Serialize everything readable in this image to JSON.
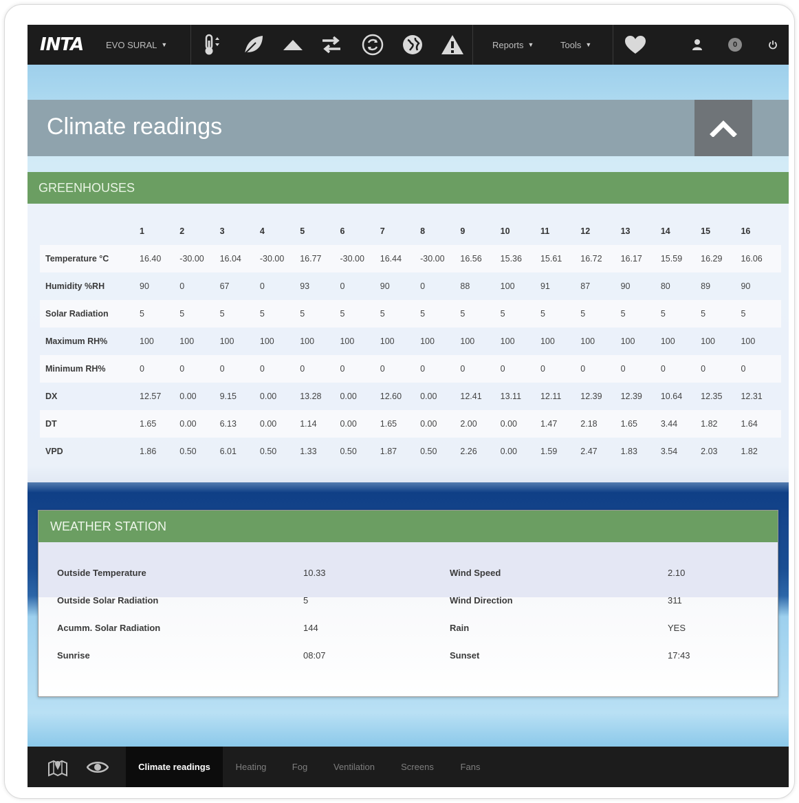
{
  "topbar": {
    "logo": "INTA",
    "site_selector": "EVO SURAL",
    "reports": "Reports",
    "tools": "Tools",
    "badge_count": "0",
    "icons": [
      "thermometer-icon",
      "leaf-icon",
      "triangle-up-icon",
      "exchange-icon",
      "refresh-icon",
      "globe-icon",
      "warning-icon",
      "heart-icon",
      "user-icon",
      "power-icon"
    ]
  },
  "title": "Climate readings",
  "greenhouses": {
    "header": "GREENHOUSES",
    "columns": [
      "1",
      "2",
      "3",
      "4",
      "5",
      "6",
      "7",
      "8",
      "9",
      "10",
      "11",
      "12",
      "13",
      "14",
      "15",
      "16"
    ],
    "rows": [
      {
        "label": "Temperature °C",
        "values": [
          "16.40",
          "-30.00",
          "16.04",
          "-30.00",
          "16.77",
          "-30.00",
          "16.44",
          "-30.00",
          "16.56",
          "15.36",
          "15.61",
          "16.72",
          "16.17",
          "15.59",
          "16.29",
          "16.06"
        ]
      },
      {
        "label": "Humidity %RH",
        "values": [
          "90",
          "0",
          "67",
          "0",
          "93",
          "0",
          "90",
          "0",
          "88",
          "100",
          "91",
          "87",
          "90",
          "80",
          "89",
          "90"
        ]
      },
      {
        "label": "Solar Radiation",
        "values": [
          "5",
          "5",
          "5",
          "5",
          "5",
          "5",
          "5",
          "5",
          "5",
          "5",
          "5",
          "5",
          "5",
          "5",
          "5",
          "5"
        ]
      },
      {
        "label": "Maximum RH%",
        "values": [
          "100",
          "100",
          "100",
          "100",
          "100",
          "100",
          "100",
          "100",
          "100",
          "100",
          "100",
          "100",
          "100",
          "100",
          "100",
          "100"
        ]
      },
      {
        "label": "Minimum RH%",
        "values": [
          "0",
          "0",
          "0",
          "0",
          "0",
          "0",
          "0",
          "0",
          "0",
          "0",
          "0",
          "0",
          "0",
          "0",
          "0",
          "0"
        ]
      },
      {
        "label": "DX",
        "values": [
          "12.57",
          "0.00",
          "9.15",
          "0.00",
          "13.28",
          "0.00",
          "12.60",
          "0.00",
          "12.41",
          "13.11",
          "12.11",
          "12.39",
          "12.39",
          "10.64",
          "12.35",
          "12.31"
        ]
      },
      {
        "label": "DT",
        "values": [
          "1.65",
          "0.00",
          "6.13",
          "0.00",
          "1.14",
          "0.00",
          "1.65",
          "0.00",
          "2.00",
          "0.00",
          "1.47",
          "2.18",
          "1.65",
          "3.44",
          "1.82",
          "1.64"
        ]
      },
      {
        "label": "VPD",
        "values": [
          "1.86",
          "0.50",
          "6.01",
          "0.50",
          "1.33",
          "0.50",
          "1.87",
          "0.50",
          "2.26",
          "0.00",
          "1.59",
          "2.47",
          "1.83",
          "3.54",
          "2.03",
          "1.82"
        ]
      }
    ]
  },
  "weather": {
    "header": "WEATHER STATION",
    "rows": [
      {
        "label1": "Outside Temperature",
        "value1": "10.33",
        "label2": "Wind Speed",
        "value2": "2.10"
      },
      {
        "label1": "Outside Solar Radiation",
        "value1": "5",
        "label2": "Wind Direction",
        "value2": "311"
      },
      {
        "label1": "Acumm. Solar Radiation",
        "value1": "144",
        "label2": "Rain",
        "value2": "YES"
      },
      {
        "label1": "Sunrise",
        "value1": "08:07",
        "label2": "Sunset",
        "value2": "17:43"
      }
    ]
  },
  "bottom_tabs": [
    "Climate readings",
    "Heating",
    "Fog",
    "Ventilation",
    "Screens",
    "Fans"
  ],
  "bottom_icons": [
    "map-icon",
    "eye-icon"
  ],
  "colors": {
    "accent_green": "#6b9e62",
    "topbar": "#1c1c1c",
    "title_bar": "#8fa3ad"
  }
}
